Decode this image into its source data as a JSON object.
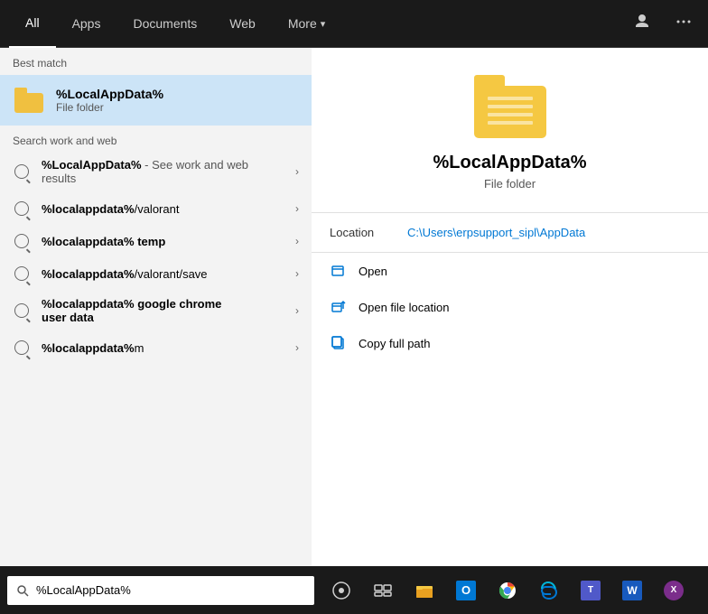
{
  "nav": {
    "tabs": [
      {
        "id": "all",
        "label": "All",
        "active": true
      },
      {
        "id": "apps",
        "label": "Apps",
        "active": false
      },
      {
        "id": "documents",
        "label": "Documents",
        "active": false
      },
      {
        "id": "web",
        "label": "Web",
        "active": false
      },
      {
        "id": "more",
        "label": "More",
        "active": false,
        "hasChevron": true
      }
    ],
    "icons": {
      "user": "👤",
      "dots": "···"
    }
  },
  "best_match": {
    "label": "Best match",
    "item": {
      "name": "%LocalAppData%",
      "type": "File folder"
    }
  },
  "search_web": {
    "label": "Search work and web",
    "items": [
      {
        "id": "sww1",
        "text_bold": "%LocalAppData%",
        "text_normal": " - See work and web results",
        "multiline": false
      },
      {
        "id": "sww2",
        "text_bold": "%localappdata%",
        "text_normal": "/valorant",
        "multiline": false
      },
      {
        "id": "sww3",
        "text_bold": "%localappdata%",
        "text_normal": " temp",
        "multiline": false
      },
      {
        "id": "sww4",
        "text_bold": "%localappdata%",
        "text_normal": "/valorant/save",
        "multiline": false
      },
      {
        "id": "sww5",
        "text_bold": "%localappdata%",
        "text_normal": " google chrome user data",
        "multiline": true,
        "line2": "user data"
      },
      {
        "id": "sww6",
        "text_bold": "%localappdata%",
        "text_normal": "m",
        "multiline": false
      }
    ]
  },
  "result_panel": {
    "title": "%LocalAppData%",
    "subtitle": "File folder",
    "location_label": "Location",
    "location_path": "C:\\Users\\erpsupport_sipl\\AppData",
    "actions": [
      {
        "id": "open",
        "label": "Open"
      },
      {
        "id": "open_file_location",
        "label": "Open file location"
      },
      {
        "id": "copy_full_path",
        "label": "Copy full path"
      }
    ]
  },
  "taskbar": {
    "search_value": "%LocalAppData%",
    "search_placeholder": "%LocalAppData%"
  },
  "colors": {
    "accent": "#0078d4",
    "nav_bg": "#1a1a1a",
    "left_bg": "#f3f3f3",
    "selected_bg": "#cce4f7"
  }
}
